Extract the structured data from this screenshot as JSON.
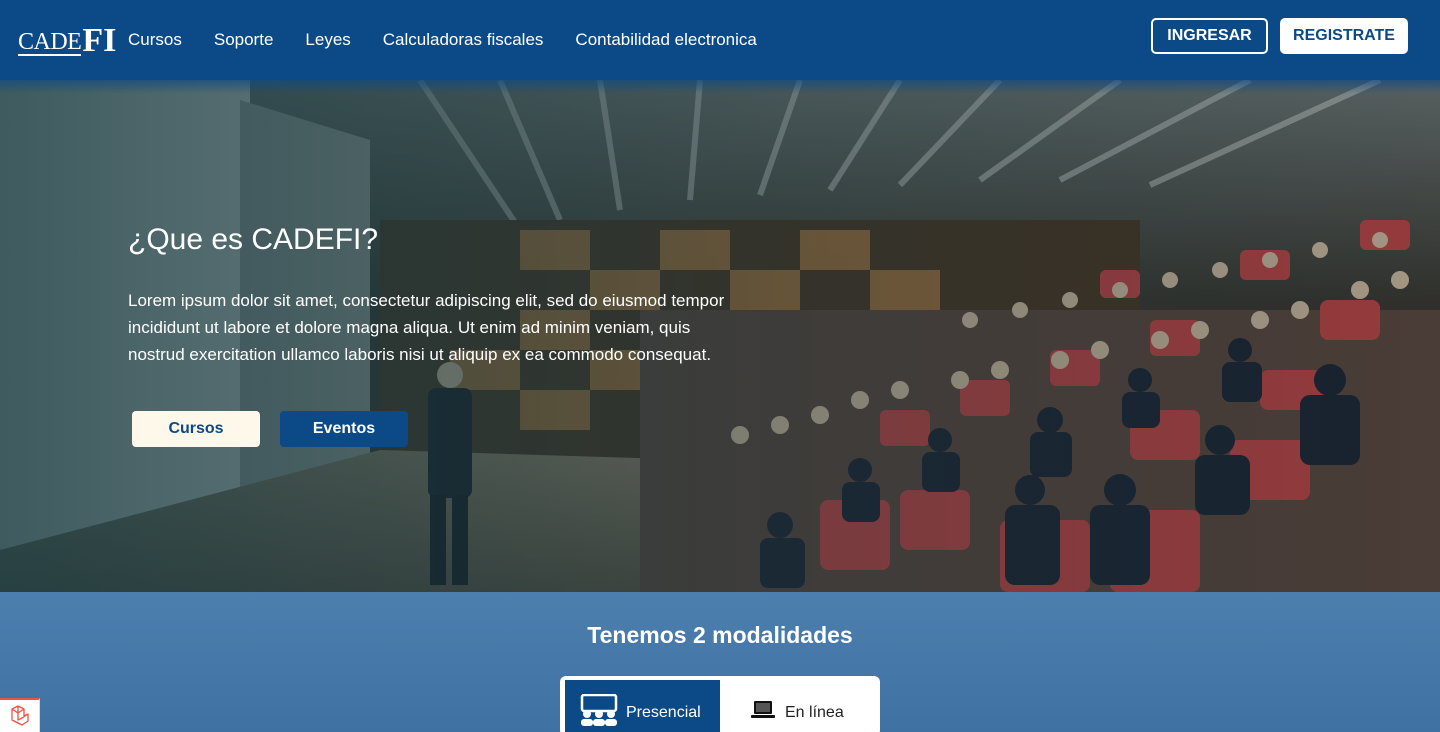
{
  "header": {
    "logo": {
      "part1": "CADE",
      "part2": "FI"
    },
    "nav": [
      "Cursos",
      "Soporte",
      "Leyes",
      "Calculadoras fiscales",
      "Contabilidad electronica"
    ],
    "login_label": "INGRESAR",
    "register_label": "REGISTRATE"
  },
  "hero": {
    "title": "¿Que es CADEFI?",
    "text": "Lorem ipsum dolor sit amet, consectetur adipiscing elit, sed do eiusmod tempor incididunt ut labore et dolore magna aliqua. Ut enim ad minim veniam, quis nostrud exercitation ullamco laboris nisi ut aliquip ex ea commodo consequat.",
    "buttons": {
      "cursos": "Cursos",
      "eventos": "Eventos"
    }
  },
  "modalidades": {
    "title": "Tenemos 2 modalidades",
    "tabs": [
      {
        "label": "Presencial",
        "icon": "people-icon",
        "active": true
      },
      {
        "label": "En línea",
        "icon": "laptop-icon",
        "active": false
      }
    ]
  },
  "colors": {
    "primary": "#0b4a86",
    "section_bg": "#4c7fae",
    "cream": "#fdf8ea"
  }
}
